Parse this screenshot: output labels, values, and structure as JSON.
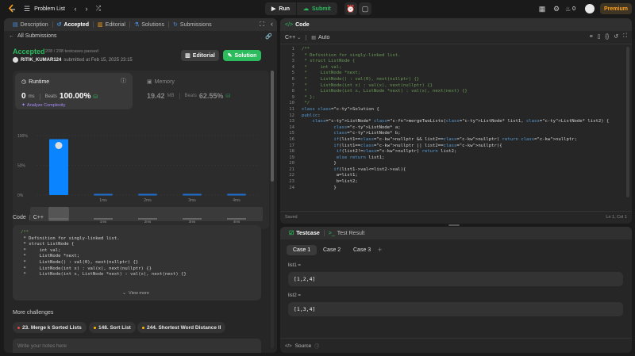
{
  "topbar": {
    "problem_list": "Problem List",
    "run": "Run",
    "submit": "Submit",
    "fire_count": "0",
    "premium": "Premium"
  },
  "left_tabs": [
    "Description",
    "Accepted",
    "Editorial",
    "Solutions",
    "Submissions"
  ],
  "submission": {
    "back_label": "All Submissions",
    "status": "Accepted",
    "passed": "208 / 208 testcases passed",
    "user": "RITIK_KUMAR124",
    "submitted_at": "submitted at Feb 15, 2025 23:15",
    "editorial_btn": "Editorial",
    "solution_btn": "Solution"
  },
  "runtime": {
    "label": "Runtime",
    "value": "0",
    "unit": "ms",
    "beats_label": "Beats",
    "beats": "100.00%",
    "analyze": "Analyze Complexity"
  },
  "memory": {
    "label": "Memory",
    "value": "19.42",
    "unit": "MB",
    "beats_label": "Beats",
    "beats": "62.55%"
  },
  "chart_data": {
    "type": "bar",
    "categories": [
      "0ms",
      "1ms",
      "2ms",
      "3ms",
      "4ms"
    ],
    "values": [
      94,
      2,
      2,
      2,
      2
    ],
    "ytick_labels": [
      "100%",
      "50%",
      "0%"
    ],
    "ylim": [
      0,
      100
    ],
    "highlighted": "0ms",
    "title": "",
    "xlabel": "",
    "ylabel": ""
  },
  "code_section": {
    "label": "Code",
    "lang": "C++",
    "view_more": "View more",
    "lines": [
      "/**",
      " * Definition for singly-linked list.",
      " * struct ListNode {",
      " *     int val;",
      " *     ListNode *next;",
      " *     ListNode() : val(0), next(nullptr) {}",
      " *     ListNode(int x) : val(x), next(nullptr) {}",
      " *     ListNode(int x, ListNode *next) : val(x), next(next) {}"
    ]
  },
  "more_challenges": {
    "title": "More challenges",
    "items": [
      {
        "label": "23. Merge k Sorted Lists",
        "color": "#ef4743"
      },
      {
        "label": "148. Sort List",
        "color": "#ffb800"
      },
      {
        "label": "244. Shortest Word Distance II",
        "color": "#ffb800"
      }
    ]
  },
  "notes_placeholder": "Write your notes here",
  "editor": {
    "title": "Code",
    "lang": "C++",
    "auto": "Auto",
    "saved": "Saved",
    "cursor": "Ln 1, Col 1",
    "lines": [
      "/**",
      " * Definition for singly-linked list.",
      " * struct ListNode {",
      " *     int val;",
      " *     ListNode *next;",
      " *     ListNode() : val(0), next(nullptr) {}",
      " *     ListNode(int x) : val(x), next(nullptr) {}",
      " *     ListNode(int x, ListNode *next) : val(x), next(next) {}",
      " * };",
      " */",
      "class Solution {",
      "public:",
      "    ListNode* mergeTwoLists(ListNode* list1, ListNode* list2) {",
      "            ListNode* a;",
      "            ListNode* b;",
      "            if(list1==nullptr && list2==nullptr) return nullptr;",
      "            if(list1==nullptr || list2==nullptr){",
      "             if(list2!=nullptr) return list2;",
      "             else return list1;",
      "            }",
      "            if(list1->val<=list2->val){",
      "             a=list1;",
      "             b=list2;",
      "            }"
    ]
  },
  "testcase": {
    "tab_testcase": "Testcase",
    "tab_result": "Test Result",
    "cases": [
      "Case 1",
      "Case 2",
      "Case 3"
    ],
    "add": "+",
    "params": [
      {
        "name": "list1 =",
        "value": "[1,2,4]"
      },
      {
        "name": "list2 =",
        "value": "[1,3,4]"
      }
    ],
    "source": "Source"
  }
}
